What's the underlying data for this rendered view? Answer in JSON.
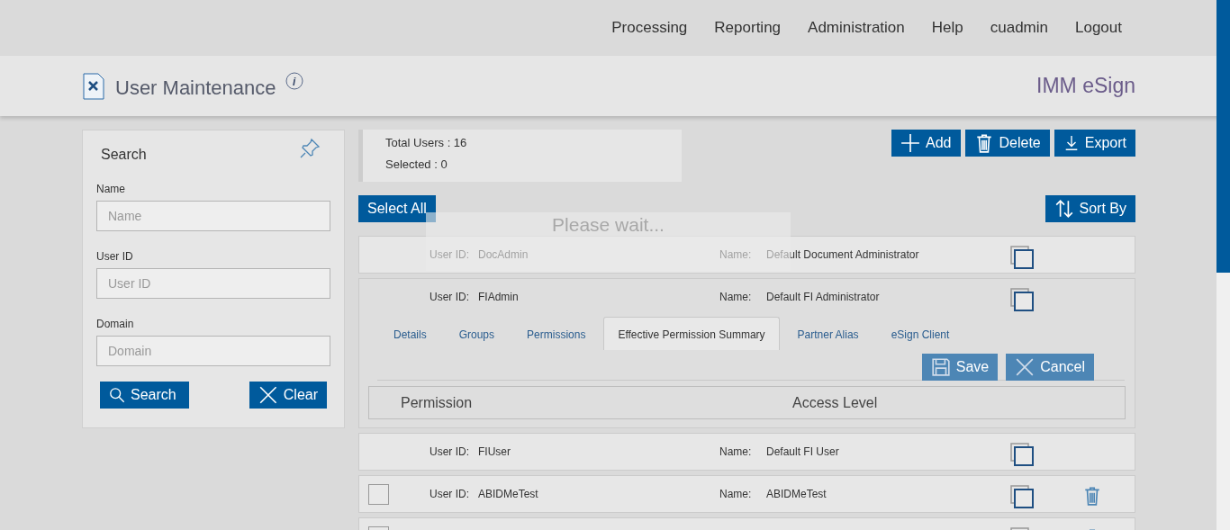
{
  "nav": [
    "Processing",
    "Reporting",
    "Administration",
    "Help",
    "cuadmin",
    "Logout"
  ],
  "header": {
    "title": "User Maintenance",
    "info": "i",
    "brand": "IMM eSign"
  },
  "search": {
    "title": "Search",
    "fields": [
      {
        "label": "Name",
        "placeholder": "Name"
      },
      {
        "label": "User ID",
        "placeholder": "User ID"
      },
      {
        "label": "Domain",
        "placeholder": "Domain"
      }
    ],
    "search_button": "Search",
    "clear_button": "Clear"
  },
  "summary": {
    "total": "Total Users : 16",
    "selected": "Selected : 0"
  },
  "actions": [
    "Add",
    "Delete",
    "Export"
  ],
  "select_all": "Select All",
  "sort_by": "Sort By",
  "loading": "Please wait...",
  "users": [
    {
      "id_label": "User ID:",
      "id": "DocAdmin",
      "name_label": "Name:",
      "name": "Default Document Administrator",
      "selectable": false,
      "deletable": false,
      "expanded": false
    },
    {
      "id_label": "User ID:",
      "id": "FIAdmin",
      "name_label": "Name:",
      "name": "Default FI Administrator",
      "selectable": false,
      "deletable": false,
      "expanded": true,
      "tabs": [
        {
          "label": "Details",
          "selected": false
        },
        {
          "label": "Groups",
          "selected": false
        },
        {
          "label": "Permissions",
          "selected": false
        },
        {
          "label": "Effective Permission Summary",
          "selected": true
        },
        {
          "label": "Partner Alias",
          "selected": false
        },
        {
          "label": "eSign Client",
          "selected": false
        }
      ],
      "save": "Save",
      "cancel": "Cancel",
      "columns": [
        "Permission",
        "Access Level"
      ]
    },
    {
      "id_label": "User ID:",
      "id": "FIUser",
      "name_label": "Name:",
      "name": "Default FI User",
      "selectable": false,
      "deletable": false,
      "expanded": false
    },
    {
      "id_label": "User ID:",
      "id": "ABIDMeTest",
      "name_label": "Name:",
      "name": "ABIDMeTest",
      "selectable": true,
      "checked": false,
      "deletable": true,
      "expanded": false
    },
    {
      "selectable": true,
      "checked": false,
      "deletable": true,
      "expanded": false
    }
  ]
}
